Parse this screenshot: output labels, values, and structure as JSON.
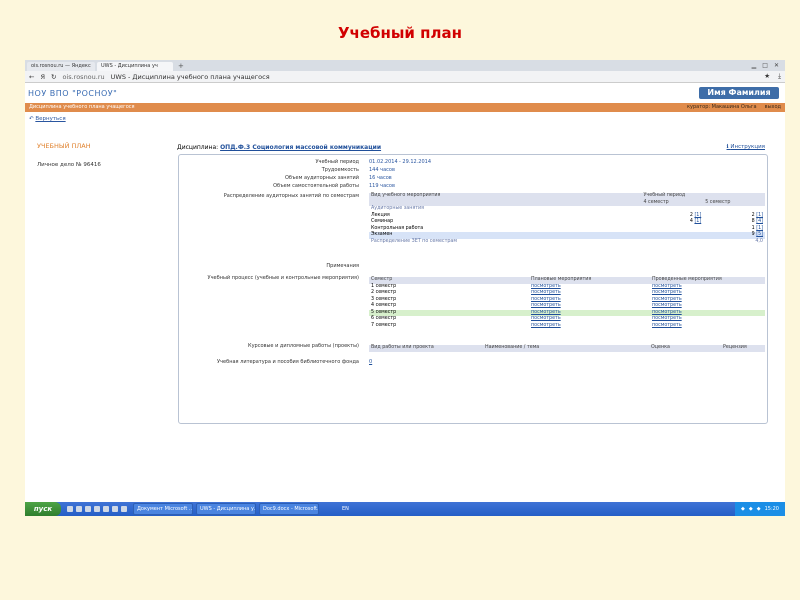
{
  "slide": {
    "title": "Учебный план"
  },
  "browser": {
    "tabs": [
      "ois.rosnou.ru — Яндекс",
      "UWS - Дисциплина уч",
      "+"
    ],
    "address_host": "ois.rosnou.ru",
    "address_title": "UWS - Дисциплина учебного плана учащегося"
  },
  "site": {
    "title": "НОУ ВПО \"РОСНОУ\"",
    "user_button": "Имя Фамилия",
    "bar_left": "Дисциплина учебного плана учащегося",
    "curator": "куратор: Макашина Ольга",
    "exit": "выход",
    "back": "Вернуться"
  },
  "sidebar": {
    "plan": "УЧЕБНЫЙ ПЛАН",
    "personal_file": "Личное дело № 96416"
  },
  "discipline": {
    "label": "Дисциплина:",
    "name": "ОПД.Ф.3 Социология массовой коммуникации",
    "instruction": "Инструкция"
  },
  "fields": {
    "period_label": "Учебный период",
    "period_start": "01.02.2014",
    "period_end": "- 29.12.2014",
    "labor_label": "Трудоемкость",
    "labor_value": "144 часов",
    "class_label": "Объем аудиторных занятий",
    "class_value": "16 часов",
    "self_label": "Объем самостоятельной работы",
    "self_value": "119 часов",
    "distrib_label": "Распределение аудиторных занятий по семестрам",
    "notes_label": "Примечания",
    "process_label": "Учебный процесс (учебные и контрольные мероприятия)",
    "course_label": "Курсовые и дипломные работы (проекты)",
    "lit_label": "Учебная литература и пособия библиотечного фонда",
    "lit_value": "0"
  },
  "distribution": {
    "col_type": "Вид учебного мероприятия",
    "col_period": "Учебный период",
    "sem4": "4 семестр",
    "sem5": "5 семестр",
    "group": "Аудиторные занятия",
    "rows": [
      {
        "name": "Лекция",
        "s4": "2",
        "s4b": "[1]",
        "s5": "2",
        "s5b": "[1]"
      },
      {
        "name": "Семинар",
        "s4": "4",
        "s4b": "[1]",
        "s5": "8",
        "s5b": "[4]"
      },
      {
        "name": "Контрольная работа",
        "s4": "",
        "s4b": "",
        "s5": "1",
        "s5b": "[1]"
      },
      {
        "name": "Экзамен",
        "s4": "",
        "s4b": "",
        "s5": "9",
        "s5b": "[5]"
      }
    ],
    "zet_label": "Распределение ЗЕТ по семестрам",
    "zet_value": "4,0"
  },
  "process": {
    "col1": "Семестр",
    "col2": "Плановые мероприятия",
    "col3": "Проведенные мероприятия",
    "link": "посмотреть",
    "rows": [
      "1 семестр",
      "2 семестр",
      "3 семестр",
      "4 семестр",
      "5 семестр",
      "6 семестр",
      "7 семестр"
    ]
  },
  "coursework": {
    "col1": "Вид работы или проекта",
    "col2": "Наименование / тема",
    "col3": "Оценка",
    "col4": "Рецензия"
  },
  "taskbar": {
    "start": "пуск",
    "buttons": [
      "Документ Microsoft ...",
      "UWS - Дисциплина у...",
      "Doc9.docx - Microsoft..."
    ],
    "lang": "EN",
    "time": "15:20"
  }
}
